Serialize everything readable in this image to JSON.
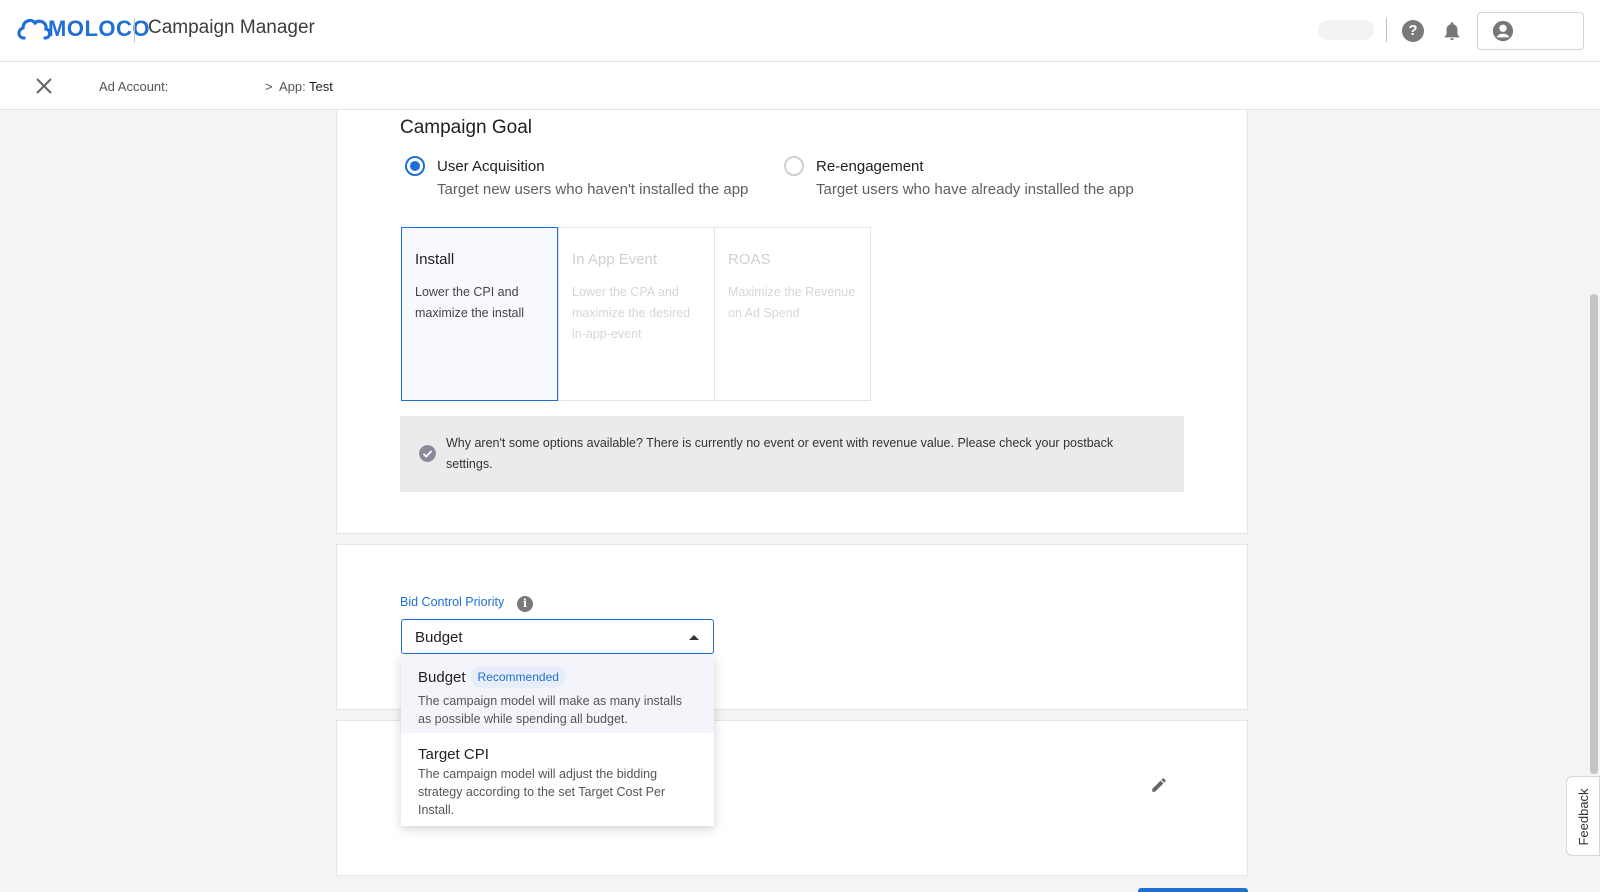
{
  "header": {
    "logo_text": "MOLOCO",
    "app_title": "Campaign Manager",
    "icons": [
      "help-icon",
      "bell-icon",
      "account-icon"
    ]
  },
  "breadcrumb": {
    "account_label": "Ad Account:",
    "separator": ">",
    "app_label": "App:",
    "app_value": "Test"
  },
  "campaign_goal": {
    "title": "Campaign Goal",
    "options": [
      {
        "label": "User Acquisition",
        "description": "Target new users who haven't installed the app",
        "checked": true
      },
      {
        "label": "Re-engagement",
        "description": "Target users who have already installed the app",
        "checked": false
      }
    ],
    "goals": [
      {
        "title": "Install",
        "description": "Lower the CPI and maximize the install",
        "state": "selected"
      },
      {
        "title": "In App Event",
        "description": "Lower the CPA and maximize the desired in-app-event",
        "state": "disabled"
      },
      {
        "title": "ROAS",
        "description": "Maximize the Revenue on Ad Spend",
        "state": "disabled"
      }
    ],
    "notice": "Why aren't some options available? There is currently no event or event with revenue value. Please check your postback settings."
  },
  "bid_control": {
    "label": "Bid Control Priority",
    "selected": "Budget",
    "options": [
      {
        "title": "Budget",
        "badge": "Recommended",
        "description": "The campaign model will make as many installs as possible while spending all budget."
      },
      {
        "title": "Target CPI",
        "description": "The campaign model will adjust the bidding strategy according to the set Target Cost Per Install."
      }
    ]
  },
  "targeting_summary": "",
  "footer_text": "",
  "feedback_label": "Feedback",
  "colors": {
    "accent": "#1f6fd6",
    "background": "#f4f4f4",
    "notice_bg": "#ebebeb"
  }
}
